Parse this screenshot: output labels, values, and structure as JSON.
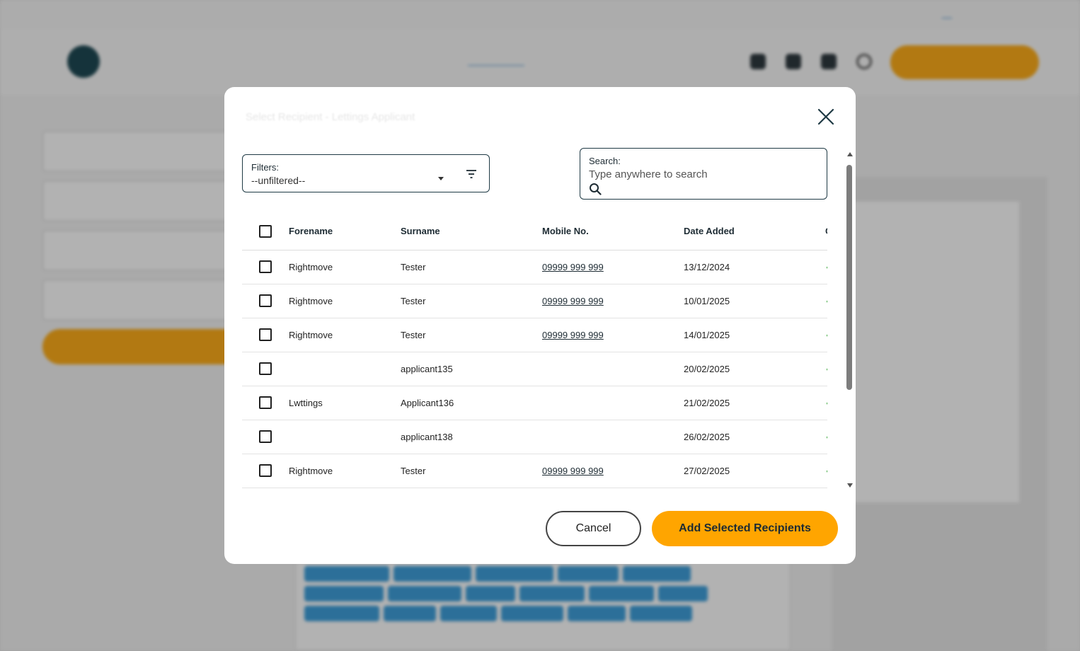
{
  "background": {
    "topbar_links": [
      "",
      "",
      "",
      ""
    ],
    "nav_items": [
      "",
      "",
      "",
      "",
      "",
      ""
    ],
    "my_account_label": ""
  },
  "modal": {
    "title": "Select Recipient - Lettings Applicant",
    "filters": {
      "label": "Filters:",
      "value": "--unfiltered--"
    },
    "search": {
      "label": "Search:",
      "placeholder": "Type anywhere to search"
    },
    "table": {
      "headers": {
        "forename": "Forename",
        "surname": "Surname",
        "mobile": "Mobile No.",
        "date_added": "Date Added"
      },
      "rows": [
        {
          "forename": "Rightmove",
          "surname": "Tester",
          "mobile": "09999 999 999",
          "date_added": "13/12/2024"
        },
        {
          "forename": "Rightmove",
          "surname": "Tester",
          "mobile": "09999 999 999",
          "date_added": "10/01/2025"
        },
        {
          "forename": "Rightmove",
          "surname": "Tester",
          "mobile": "09999 999 999",
          "date_added": "14/01/2025"
        },
        {
          "forename": "",
          "surname": "applicant135",
          "mobile": "",
          "date_added": "20/02/2025"
        },
        {
          "forename": "Lwttings",
          "surname": "Applicant136",
          "mobile": "",
          "date_added": "21/02/2025"
        },
        {
          "forename": "",
          "surname": "applicant138",
          "mobile": "",
          "date_added": "26/02/2025"
        },
        {
          "forename": "Rightmove",
          "surname": "Tester",
          "mobile": "09999 999 999",
          "date_added": "27/02/2025"
        }
      ]
    },
    "cancel_label": "Cancel",
    "add_label": "Add Selected Recipients"
  },
  "colors": {
    "accent": "#ffa500",
    "border": "#1f3a45",
    "status_green": "#2ca02c"
  }
}
